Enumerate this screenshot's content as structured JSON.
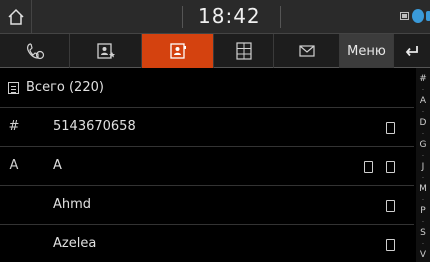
{
  "status": {
    "time": "18:42"
  },
  "tabs": [
    {
      "icon": "call-history-icon"
    },
    {
      "icon": "favorites-contacts-icon"
    },
    {
      "icon": "contacts-icon",
      "active": true
    },
    {
      "icon": "dial-pad-icon"
    },
    {
      "icon": "messages-icon"
    }
  ],
  "menu_label": "Меню",
  "list": {
    "total_label": "Всего (220)",
    "rows": [
      {
        "letter": "#",
        "name": "5143670658",
        "devices": 1
      },
      {
        "letter": "A",
        "name": "A",
        "devices": 2
      },
      {
        "letter": "",
        "name": "Ahmd",
        "devices": 1
      },
      {
        "letter": "",
        "name": "Azelea",
        "devices": 1
      }
    ]
  },
  "alphabet": [
    "#",
    "·",
    "A",
    "·",
    "D",
    "·",
    "G",
    "·",
    "J",
    "·",
    "M",
    "·",
    "P",
    "·",
    "S",
    "·",
    "V"
  ],
  "colors": {
    "accent": "#d4420f",
    "bluetooth": "#3a9ad9"
  }
}
